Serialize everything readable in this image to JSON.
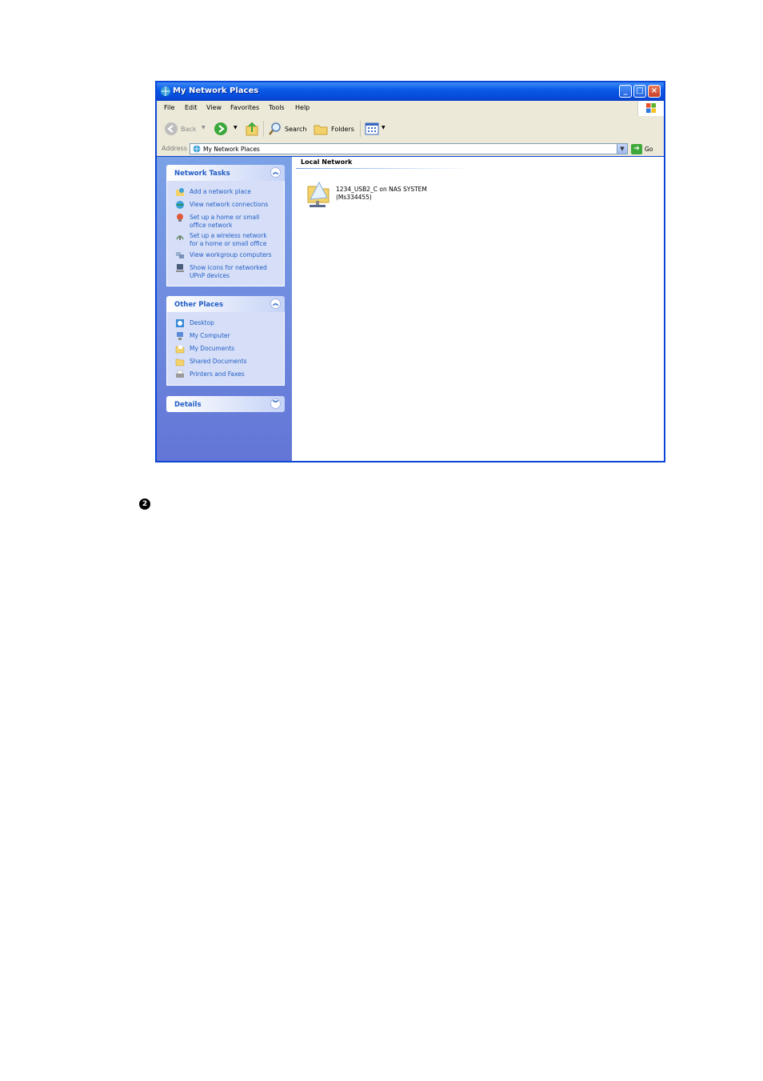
{
  "window": {
    "title": "My Network Places",
    "controls": {
      "minimize": "_",
      "maximize": "□",
      "close": "×"
    }
  },
  "menubar": {
    "items": [
      "File",
      "Edit",
      "View",
      "Favorites",
      "Tools",
      "Help"
    ]
  },
  "toolbar": {
    "back_label": "Back",
    "search_label": "Search",
    "folders_label": "Folders"
  },
  "address": {
    "label": "Address",
    "value": "My Network Places",
    "go_label": "Go"
  },
  "network_tasks": {
    "title": "Network Tasks",
    "items": [
      {
        "label": "Add a network place",
        "icon": "add-network-place-icon"
      },
      {
        "label": "View network connections",
        "icon": "network-connections-icon"
      },
      {
        "label": "Set up a home or small\noffice network",
        "icon": "home-network-icon"
      },
      {
        "label": "Set up a wireless network\nfor a home or small office",
        "icon": "wireless-network-icon"
      },
      {
        "label": "View workgroup computers",
        "icon": "workgroup-icon"
      },
      {
        "label": "Show icons for networked\nUPnP devices",
        "icon": "upnp-icon"
      }
    ]
  },
  "other_places": {
    "title": "Other Places",
    "items": [
      {
        "label": "Desktop",
        "icon": "desktop-icon"
      },
      {
        "label": "My Computer",
        "icon": "my-computer-icon"
      },
      {
        "label": "My Documents",
        "icon": "my-documents-icon"
      },
      {
        "label": "Shared Documents",
        "icon": "shared-documents-icon"
      },
      {
        "label": "Printers and Faxes",
        "icon": "printers-icon"
      }
    ]
  },
  "details": {
    "title": "Details"
  },
  "content": {
    "group_title": "Local Network",
    "items": [
      {
        "line1": "1234_USB2_C on NAS SYSTEM",
        "line2": "(Ms334455)"
      }
    ]
  },
  "note": {
    "bullet": "2"
  }
}
